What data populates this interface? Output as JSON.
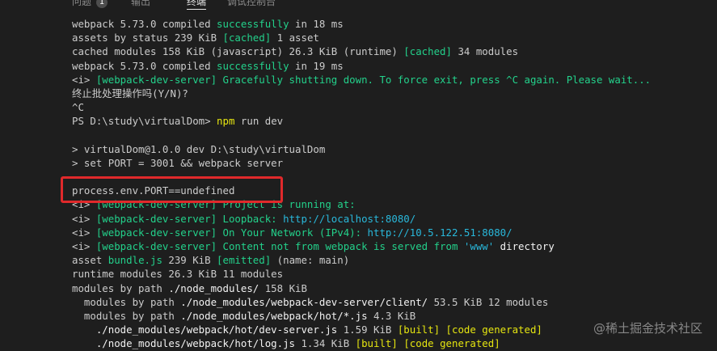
{
  "tabs": [
    {
      "label": "问题",
      "badge": "1"
    },
    {
      "label": "输出"
    },
    {
      "label": "终端",
      "active": true
    },
    {
      "label": "调试控制台"
    }
  ],
  "terminal": {
    "lines": [
      [
        {
          "t": "webpack 5.73.0 compiled "
        },
        {
          "t": "successfully",
          "c": "green"
        },
        {
          "t": " in 18 ms"
        }
      ],
      [
        {
          "t": "assets by status 239 KiB "
        },
        {
          "t": "[cached]",
          "c": "green"
        },
        {
          "t": " 1 asset"
        }
      ],
      [
        {
          "t": "cached modules 158 KiB (javascript) 26.3 KiB (runtime) "
        },
        {
          "t": "[cached]",
          "c": "green"
        },
        {
          "t": " 34 modules"
        }
      ],
      [
        {
          "t": "webpack 5.73.0 compiled "
        },
        {
          "t": "successfully",
          "c": "green"
        },
        {
          "t": " in 19 ms"
        }
      ],
      [
        {
          "t": "<i> "
        },
        {
          "t": "[webpack-dev-server] Gracefully shutting down. To force exit, press ^C again. Please wait...",
          "c": "green"
        }
      ],
      [
        {
          "t": "终止批处理操作吗(Y/N)?"
        }
      ],
      [
        {
          "t": "^C"
        }
      ],
      [
        {
          "t": "PS D:\\study\\virtualDom> "
        },
        {
          "t": "npm",
          "c": "yellow"
        },
        {
          "t": " run dev"
        }
      ],
      [
        {
          "t": ""
        }
      ],
      [
        {
          "t": "> virtualDom@1.0.0 dev D:\\study\\virtualDom"
        }
      ],
      [
        {
          "t": "> set PORT = 3001 && webpack server"
        }
      ],
      [
        {
          "t": ""
        }
      ],
      [
        {
          "t": "process.env.PORT==undefined"
        }
      ],
      [
        {
          "t": "<i> "
        },
        {
          "t": "[webpack-dev-server] Project is running at:",
          "c": "green"
        }
      ],
      [
        {
          "t": "<i> "
        },
        {
          "t": "[webpack-dev-server] Loopback: ",
          "c": "green"
        },
        {
          "t": "http://localhost:8080/",
          "c": "cyan"
        }
      ],
      [
        {
          "t": "<i> "
        },
        {
          "t": "[webpack-dev-server] On Your Network (IPv4): ",
          "c": "green"
        },
        {
          "t": "http://10.5.122.51:8080/",
          "c": "cyan"
        }
      ],
      [
        {
          "t": "<i> "
        },
        {
          "t": "[webpack-dev-server] Content not from webpack is served from ",
          "c": "green"
        },
        {
          "t": "'www'",
          "c": "cyan"
        },
        {
          "t": " directory",
          "c": "bright"
        }
      ],
      [
        {
          "t": "asset "
        },
        {
          "t": "bundle.js",
          "c": "green"
        },
        {
          "t": " 239 KiB "
        },
        {
          "t": "[emitted]",
          "c": "green"
        },
        {
          "t": " (name: main)"
        }
      ],
      [
        {
          "t": "runtime modules 26.3 KiB 11 modules"
        }
      ],
      [
        {
          "t": "modules by path "
        },
        {
          "t": "./node_modules/",
          "c": "bright"
        },
        {
          "t": " 158 KiB"
        }
      ],
      [
        {
          "t": "  modules by path "
        },
        {
          "t": "./node_modules/webpack-dev-server/client/",
          "c": "bright"
        },
        {
          "t": " 53.5 KiB 12 modules"
        }
      ],
      [
        {
          "t": "  modules by path "
        },
        {
          "t": "./node_modules/webpack/hot/*.js",
          "c": "bright"
        },
        {
          "t": " 4.3 KiB"
        }
      ],
      [
        {
          "t": "    ./node_modules/webpack/hot/dev-server.js",
          "c": "bright"
        },
        {
          "t": " 1.59 KiB "
        },
        {
          "t": "[built]",
          "c": "yellow"
        },
        {
          "t": " "
        },
        {
          "t": "[code generated]",
          "c": "yellow"
        }
      ],
      [
        {
          "t": "    ./node_modules/webpack/hot/log.js",
          "c": "bright"
        },
        {
          "t": " 1.34 KiB "
        },
        {
          "t": "[built]",
          "c": "yellow"
        },
        {
          "t": " "
        },
        {
          "t": "[code generated]",
          "c": "yellow"
        }
      ]
    ]
  },
  "watermark": "@稀土掘金技术社区",
  "colors": {
    "background": "#1e1e1e",
    "text": "#cccccc",
    "green": "#23d18b",
    "cyan": "#29b8db",
    "yellow": "#e5e510",
    "highlight_border": "#e0292b"
  }
}
